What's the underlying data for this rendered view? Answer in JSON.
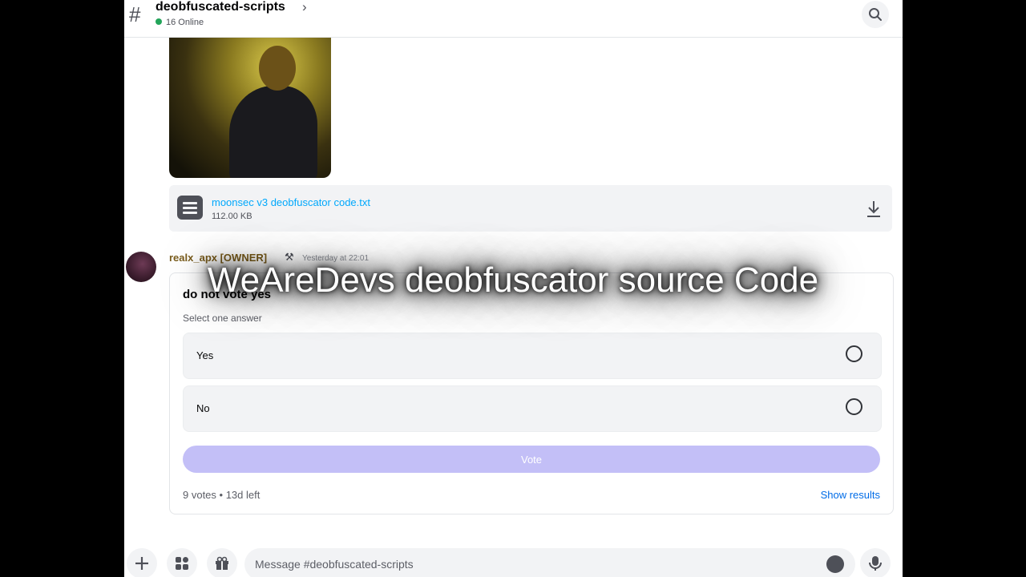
{
  "header": {
    "channel_name": "deobfuscated-scripts",
    "online_count": "16 Online"
  },
  "attachment": {
    "file_name": "moonsec v3 deobfuscator code.txt",
    "file_size": "112.00 KB"
  },
  "message": {
    "author": "realx_apx [OWNER]",
    "timestamp": "Yesterday at 22:01"
  },
  "poll": {
    "question": "do not vote yes",
    "hint": "Select one answer",
    "options": [
      {
        "label": "Yes"
      },
      {
        "label": "No"
      }
    ],
    "vote_label": "Vote",
    "summary": "9 votes • 13d left",
    "show_results_label": "Show results"
  },
  "composer": {
    "placeholder": "Message #deobfuscated-scripts"
  },
  "overlay": {
    "caption": "WeAreDevs deobfuscator source Code"
  },
  "icons": {
    "hash": "hash-icon",
    "search": "search-icon",
    "download": "download-icon",
    "file": "file-text-icon",
    "plus": "plus-icon",
    "apps": "apps-icon",
    "gift": "gift-icon",
    "emoji": "emoji-icon",
    "mic": "mic-icon"
  },
  "colors": {
    "link": "#00a8fc",
    "vote_button": "#c3bff7",
    "online": "#23a55a",
    "show_results": "#006ce7"
  }
}
